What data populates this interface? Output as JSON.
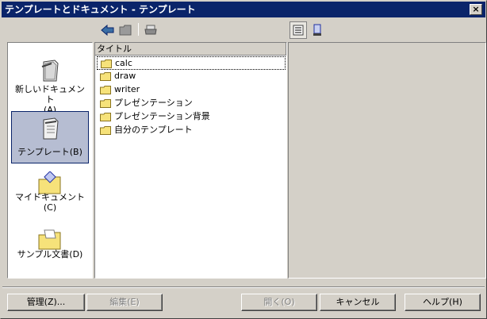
{
  "window": {
    "title": "テンプレートとドキュメント - テンプレート",
    "close_label": "×"
  },
  "toolbar": {
    "back_icon": "arrow-left-icon",
    "folder_icon": "folder-icon",
    "print_icon": "printer-icon",
    "view_list_icon": "list-view-icon",
    "preview_icon": "document-preview-icon",
    "active_view": "list-view"
  },
  "categories": [
    {
      "label": "新しいドキュメント",
      "mnemonic": "(A)",
      "icon": "new-document-icon",
      "selected": false
    },
    {
      "label": "テンプレート",
      "mnemonic": "(B)",
      "icon": "templates-icon",
      "selected": true
    },
    {
      "label": "マイドキュメント",
      "mnemonic": "(C)",
      "icon": "my-documents-icon",
      "selected": false
    },
    {
      "label": "サンプル文書",
      "mnemonic": "(D)",
      "icon": "sample-documents-icon",
      "selected": false
    }
  ],
  "file_list": {
    "column_header": "タイトル",
    "items": [
      "calc",
      "draw",
      "writer",
      "プレゼンテーション",
      "プレゼンテーション背景",
      "自分のテンプレート"
    ]
  },
  "buttons": {
    "manage": "管理(Z)...",
    "edit": "編集(E)",
    "open": "開く(O)",
    "cancel": "キャンセル",
    "help": "ヘルプ(H)"
  },
  "colors": {
    "titlebar": "#0a246a",
    "face": "#d4d0c8",
    "selection": "#b6bdd2",
    "folder": "#f6e27a"
  }
}
